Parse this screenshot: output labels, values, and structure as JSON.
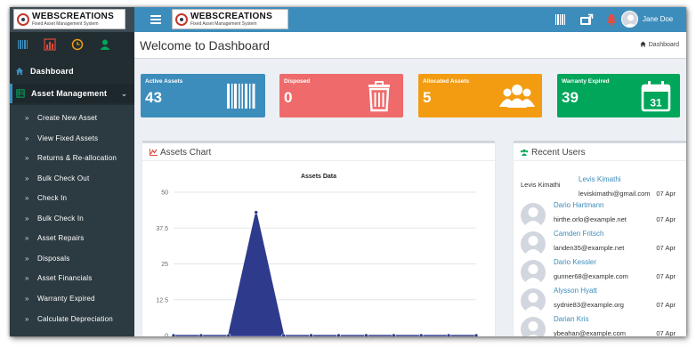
{
  "brand": {
    "title": "WEBSCREATIONS",
    "subtitle": "Fixed Asset Management System"
  },
  "topbar": {
    "user_name": "Jane Doe",
    "icons": [
      "barcode-icon",
      "export-icon",
      "bell-icon",
      "user-avatar"
    ]
  },
  "sidebar": {
    "quick_icons": [
      "barcode-icon",
      "chart-icon",
      "clock-icon",
      "user-icon"
    ],
    "dashboard_label": "Dashboard",
    "asset_management_label": "Asset Management",
    "items": [
      {
        "label": "Create New Asset"
      },
      {
        "label": "View Fixed Assets"
      },
      {
        "label": "Returns & Re-allocation"
      },
      {
        "label": "Bulk Check Out"
      },
      {
        "label": "Check In"
      },
      {
        "label": "Bulk Check In"
      },
      {
        "label": "Asset Repairs"
      },
      {
        "label": "Disposals"
      },
      {
        "label": "Asset Financials"
      },
      {
        "label": "Warranty Expired"
      },
      {
        "label": "Calculate Depreciation"
      }
    ]
  },
  "header": {
    "title": "Welcome to Dashboard",
    "breadcrumb": "Dashboard"
  },
  "info_boxes": [
    {
      "label": "Active Assets",
      "value": "43",
      "color": "#3c8dbc",
      "icon": "barcode-icon"
    },
    {
      "label": "Disposed",
      "value": "0",
      "color": "#ef6b6b",
      "icon": "trash-icon"
    },
    {
      "label": "Allocated Assets",
      "value": "5",
      "color": "#f39c12",
      "icon": "users-icon"
    },
    {
      "label": "Warranty Expired",
      "value": "39",
      "color": "#00a65a",
      "icon": "calendar-icon",
      "icon_text": "31"
    }
  ],
  "assets_panel": {
    "title": "Assets Chart"
  },
  "chart_data": {
    "type": "area",
    "title": "Assets Data",
    "xlabel": "",
    "ylabel": "",
    "yticks": [
      "50",
      "37.5",
      "25",
      "12.5",
      "0"
    ],
    "ylim": [
      0,
      50
    ],
    "grid": true,
    "series": [
      {
        "color": "#2e3a8c",
        "values": [
          0,
          0,
          0,
          43,
          0,
          0,
          0,
          0,
          0,
          0,
          0,
          0
        ]
      }
    ]
  },
  "recent_users": {
    "title": "Recent Users",
    "users": [
      {
        "name": "Levis Kimathi",
        "email": "leviskimathi@gmail.com",
        "date": "07 Apr",
        "image_alt": "Levis Kimathi"
      },
      {
        "name": "Dario Hartmann",
        "email": "hirthe.orlo@example.net",
        "date": "07 Apr"
      },
      {
        "name": "Camden Fritsch",
        "email": "landen35@example.net",
        "date": "07 Apr"
      },
      {
        "name": "Dario Kessler",
        "email": "gunner68@example.com",
        "date": "07 Apr"
      },
      {
        "name": "Alysson Hyatt",
        "email": "sydnie83@example.org",
        "date": "07 Apr"
      },
      {
        "name": "Darian Kris",
        "email": "ybeahan@example.com",
        "date": "07 Apr"
      }
    ]
  }
}
